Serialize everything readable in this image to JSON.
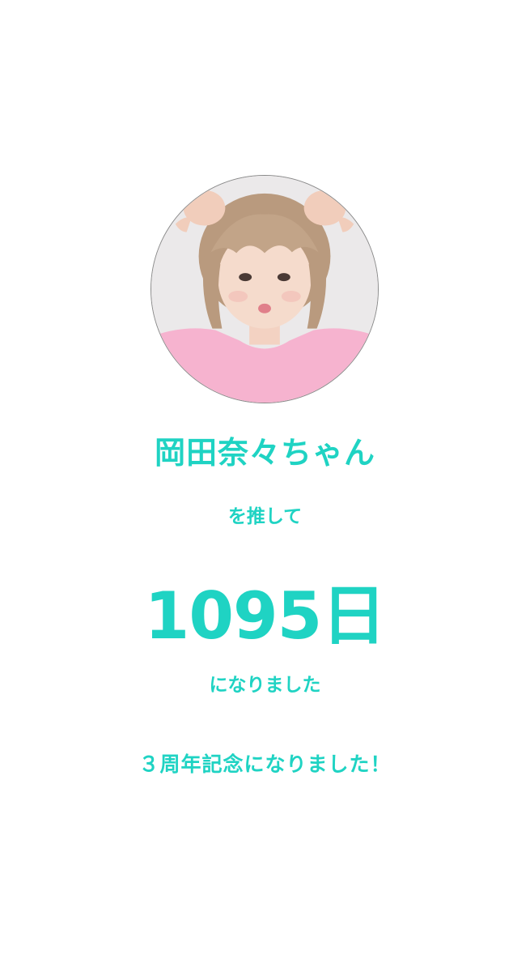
{
  "profile": {
    "avatar_icon": "person-photo-icon",
    "name": "岡田奈々ちゃん"
  },
  "message": {
    "line1": "を推して",
    "days": "1095日",
    "line2": "になりました",
    "anniversary": "３周年記念になりました！"
  },
  "colors": {
    "accent": "#1fd3c3",
    "background": "#ffffff",
    "avatar_border": "#8a8a8a"
  }
}
